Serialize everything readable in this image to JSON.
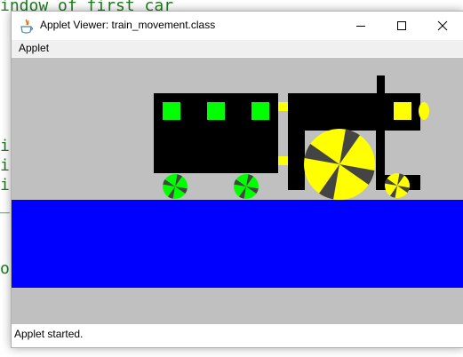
{
  "background_code": {
    "lines": [
      "indow of first car",
      "i",
      "i",
      "i",
      "_",
      "o"
    ]
  },
  "window": {
    "title": "Applet Viewer: train_movement.class",
    "menu": [
      "Applet"
    ],
    "status": "Applet started."
  },
  "scene": {
    "colors": {
      "canvas": "#c0c0c0",
      "track": "#0000ff",
      "body": "#000000",
      "car_windows": "#00ff00",
      "couplers": "#ffff00",
      "car_wheels": "#00ff00",
      "engine_wheels": "#ffff00",
      "spokes": "#444444",
      "headlight": "#ffff00"
    }
  }
}
